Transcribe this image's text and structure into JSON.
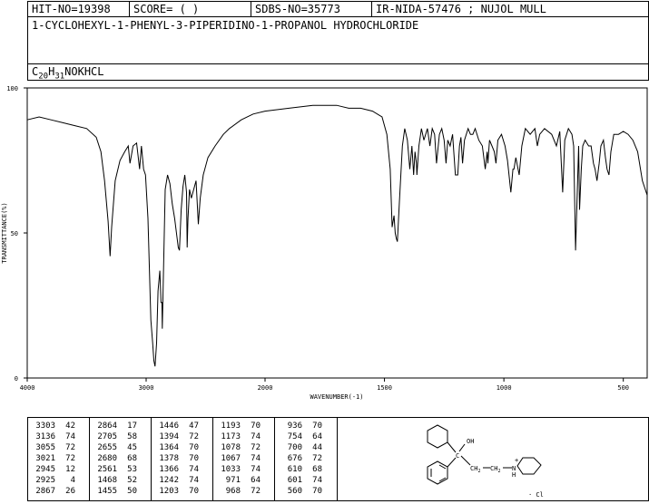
{
  "header": {
    "hit_no": "HIT-NO=19398",
    "score": "SCORE=  (   )",
    "sdbs_no": "SDBS-NO=35773",
    "ir_info": "IR-NIDA-57476 ; NUJOL MULL"
  },
  "compound": {
    "name": "1-CYCLOHEXYL-1-PHENYL-3-PIPERIDINO-1-PROPANOL HYDROCHLORIDE",
    "formula_parts": [
      "C",
      "20",
      "H",
      "31",
      "NOKHCL"
    ]
  },
  "chart_data": {
    "type": "line",
    "xlabel": "WAVENUMBER(-1)",
    "ylabel": "TRANSMITTANCE(%)",
    "xlim": [
      4000,
      400
    ],
    "ylim": [
      0,
      100
    ],
    "x_ticks": [
      "4000",
      "3000",
      "2000",
      "1500",
      "1000",
      "500"
    ],
    "x_tick_values": [
      4000,
      3000,
      2000,
      1500,
      1000,
      500
    ],
    "y_ticks": [
      "0",
      "50",
      "100"
    ],
    "y_tick_values": [
      0,
      50,
      100
    ],
    "series": [
      {
        "points": [
          [
            4000,
            89
          ],
          [
            3900,
            90
          ],
          [
            3800,
            89
          ],
          [
            3700,
            88
          ],
          [
            3600,
            87
          ],
          [
            3500,
            86
          ],
          [
            3420,
            83
          ],
          [
            3380,
            78
          ],
          [
            3350,
            68
          ],
          [
            3320,
            54
          ],
          [
            3303,
            42
          ],
          [
            3290,
            52
          ],
          [
            3260,
            68
          ],
          [
            3220,
            75
          ],
          [
            3180,
            78
          ],
          [
            3150,
            80
          ],
          [
            3136,
            74
          ],
          [
            3110,
            80
          ],
          [
            3080,
            81
          ],
          [
            3055,
            72
          ],
          [
            3040,
            80
          ],
          [
            3021,
            72
          ],
          [
            3005,
            70
          ],
          [
            2985,
            55
          ],
          [
            2960,
            20
          ],
          [
            2945,
            12
          ],
          [
            2935,
            6
          ],
          [
            2925,
            4
          ],
          [
            2912,
            12
          ],
          [
            2900,
            30
          ],
          [
            2885,
            37
          ],
          [
            2875,
            26
          ],
          [
            2867,
            26
          ],
          [
            2864,
            17
          ],
          [
            2855,
            35
          ],
          [
            2840,
            65
          ],
          [
            2820,
            70
          ],
          [
            2800,
            67
          ],
          [
            2780,
            60
          ],
          [
            2760,
            55
          ],
          [
            2745,
            50
          ],
          [
            2730,
            45
          ],
          [
            2720,
            44
          ],
          [
            2705,
            58
          ],
          [
            2690,
            66
          ],
          [
            2675,
            70
          ],
          [
            2660,
            64
          ],
          [
            2655,
            45
          ],
          [
            2648,
            55
          ],
          [
            2635,
            65
          ],
          [
            2620,
            62
          ],
          [
            2600,
            65
          ],
          [
            2580,
            68
          ],
          [
            2561,
            53
          ],
          [
            2545,
            62
          ],
          [
            2520,
            70
          ],
          [
            2480,
            76
          ],
          [
            2420,
            80
          ],
          [
            2350,
            84
          ],
          [
            2300,
            86
          ],
          [
            2200,
            89
          ],
          [
            2100,
            91
          ],
          [
            2000,
            92
          ],
          [
            1900,
            93
          ],
          [
            1800,
            94
          ],
          [
            1700,
            94
          ],
          [
            1650,
            93
          ],
          [
            1600,
            93
          ],
          [
            1550,
            92
          ],
          [
            1510,
            90
          ],
          [
            1490,
            84
          ],
          [
            1476,
            72
          ],
          [
            1468,
            52
          ],
          [
            1460,
            56
          ],
          [
            1455,
            50
          ],
          [
            1450,
            48
          ],
          [
            1446,
            47
          ],
          [
            1438,
            60
          ],
          [
            1425,
            80
          ],
          [
            1415,
            86
          ],
          [
            1404,
            82
          ],
          [
            1394,
            72
          ],
          [
            1385,
            80
          ],
          [
            1378,
            70
          ],
          [
            1372,
            78
          ],
          [
            1366,
            74
          ],
          [
            1364,
            70
          ],
          [
            1356,
            80
          ],
          [
            1345,
            86
          ],
          [
            1335,
            82
          ],
          [
            1320,
            86
          ],
          [
            1310,
            80
          ],
          [
            1300,
            86
          ],
          [
            1290,
            84
          ],
          [
            1282,
            74
          ],
          [
            1270,
            84
          ],
          [
            1260,
            86
          ],
          [
            1250,
            82
          ],
          [
            1242,
            74
          ],
          [
            1235,
            82
          ],
          [
            1225,
            80
          ],
          [
            1215,
            84
          ],
          [
            1203,
            70
          ],
          [
            1193,
            70
          ],
          [
            1186,
            80
          ],
          [
            1180,
            83
          ],
          [
            1173,
            74
          ],
          [
            1165,
            82
          ],
          [
            1150,
            86
          ],
          [
            1140,
            84
          ],
          [
            1130,
            84
          ],
          [
            1120,
            86
          ],
          [
            1105,
            82
          ],
          [
            1090,
            80
          ],
          [
            1078,
            72
          ],
          [
            1070,
            78
          ],
          [
            1067,
            74
          ],
          [
            1060,
            82
          ],
          [
            1050,
            80
          ],
          [
            1040,
            78
          ],
          [
            1033,
            74
          ],
          [
            1025,
            82
          ],
          [
            1010,
            84
          ],
          [
            995,
            80
          ],
          [
            985,
            75
          ],
          [
            971,
            64
          ],
          [
            962,
            72
          ],
          [
            958,
            72
          ],
          [
            950,
            76
          ],
          [
            936,
            70
          ],
          [
            925,
            80
          ],
          [
            910,
            86
          ],
          [
            890,
            84
          ],
          [
            870,
            86
          ],
          [
            860,
            80
          ],
          [
            850,
            84
          ],
          [
            830,
            86
          ],
          [
            800,
            84
          ],
          [
            780,
            80
          ],
          [
            766,
            85
          ],
          [
            754,
            64
          ],
          [
            745,
            82
          ],
          [
            730,
            86
          ],
          [
            715,
            84
          ],
          [
            708,
            80
          ],
          [
            700,
            44
          ],
          [
            694,
            60
          ],
          [
            687,
            80
          ],
          [
            683,
            58
          ],
          [
            676,
            72
          ],
          [
            670,
            80
          ],
          [
            660,
            82
          ],
          [
            645,
            80
          ],
          [
            635,
            80
          ],
          [
            625,
            74
          ],
          [
            618,
            72
          ],
          [
            610,
            68
          ],
          [
            604,
            72
          ],
          [
            601,
            74
          ],
          [
            594,
            80
          ],
          [
            583,
            82
          ],
          [
            575,
            76
          ],
          [
            568,
            72
          ],
          [
            560,
            70
          ],
          [
            552,
            78
          ],
          [
            540,
            84
          ],
          [
            520,
            84
          ],
          [
            500,
            85
          ],
          [
            480,
            84
          ],
          [
            460,
            82
          ],
          [
            440,
            78
          ],
          [
            420,
            68
          ],
          [
            400,
            63
          ]
        ]
      }
    ]
  },
  "peak_table": {
    "columns": [
      [
        [
          "3303",
          "42"
        ],
        [
          "3136",
          "74"
        ],
        [
          "3055",
          "72"
        ],
        [
          "3021",
          "72"
        ],
        [
          "2945",
          "12"
        ],
        [
          "2925",
          "4"
        ],
        [
          "2867",
          "26"
        ]
      ],
      [
        [
          "2864",
          "17"
        ],
        [
          "2705",
          "58"
        ],
        [
          "2655",
          "45"
        ],
        [
          "2680",
          "68"
        ],
        [
          "2561",
          "53"
        ],
        [
          "1468",
          "52"
        ],
        [
          "1455",
          "50"
        ]
      ],
      [
        [
          "1446",
          "47"
        ],
        [
          "1394",
          "72"
        ],
        [
          "1364",
          "70"
        ],
        [
          "1378",
          "70"
        ],
        [
          "1366",
          "74"
        ],
        [
          "1242",
          "74"
        ],
        [
          "1203",
          "70"
        ]
      ],
      [
        [
          "1193",
          "70"
        ],
        [
          "1173",
          "74"
        ],
        [
          "1078",
          "72"
        ],
        [
          "1067",
          "74"
        ],
        [
          "1033",
          "74"
        ],
        [
          "971",
          "64"
        ],
        [
          "968",
          "72"
        ]
      ],
      [
        [
          "936",
          "70"
        ],
        [
          "754",
          "64"
        ],
        [
          "700",
          "44"
        ],
        [
          "676",
          "72"
        ],
        [
          "610",
          "68"
        ],
        [
          "601",
          "74"
        ],
        [
          "560",
          "70"
        ]
      ]
    ]
  },
  "structure": {
    "oh_label": "OH",
    "c_label": "C",
    "chain_label": "CH",
    "chain_sub": "2",
    "n_label": "N",
    "h_label": "H",
    "plus_label": "+",
    "cl_label": "· Cl"
  }
}
